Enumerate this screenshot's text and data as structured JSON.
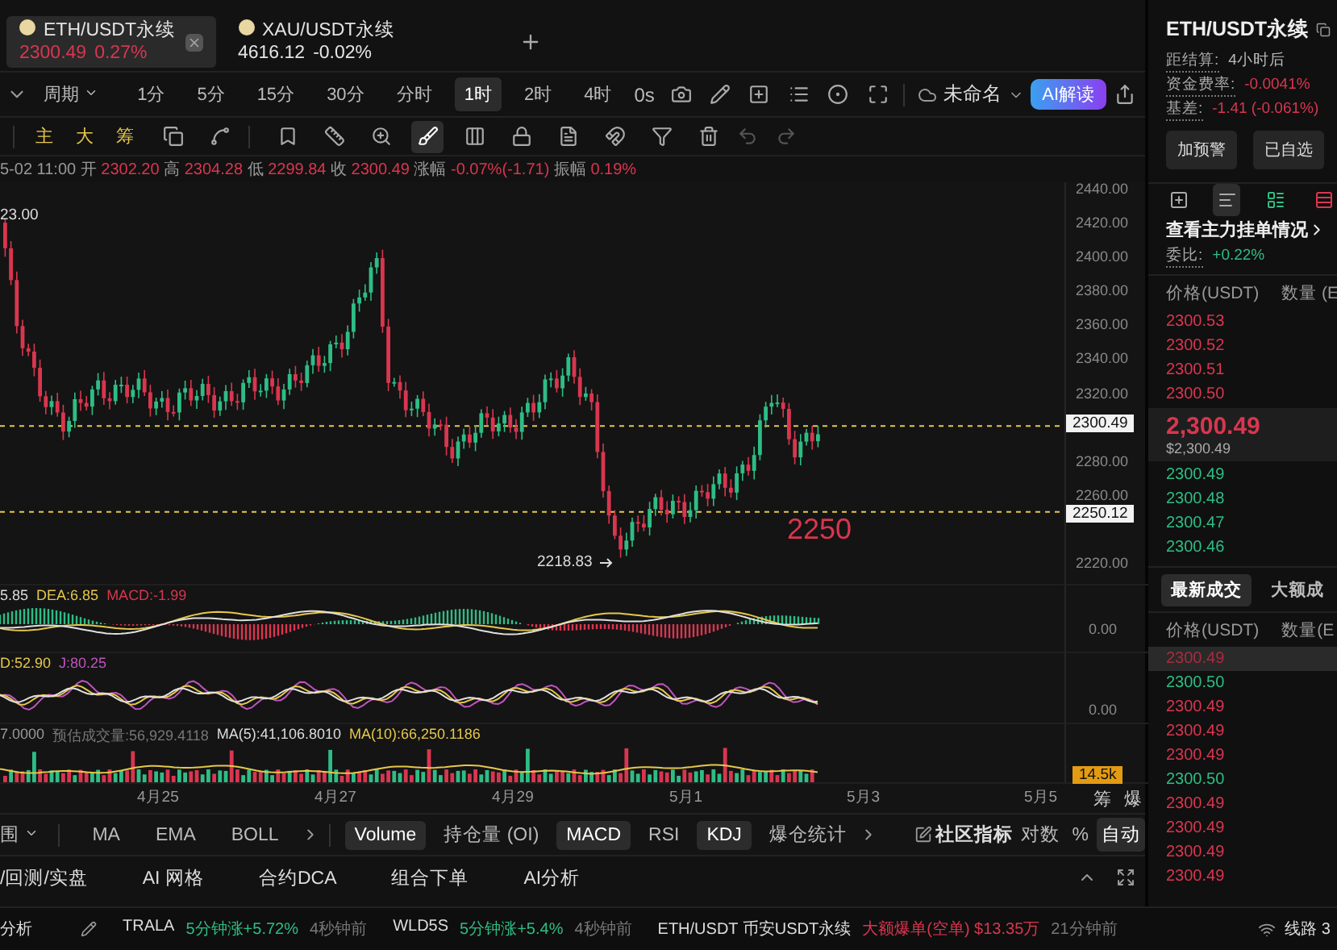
{
  "tabs": [
    {
      "symbol": "ETH/USDT永续",
      "price": "2300.49",
      "change": "0.27%",
      "selected": true
    },
    {
      "symbol": "XAU/USDT永续",
      "price": "4616.12",
      "change": "-0.02%",
      "selected": false
    }
  ],
  "timeframes": {
    "period_label": "周期",
    "items": [
      {
        "label": "1分",
        "selected": false
      },
      {
        "label": "5分",
        "selected": false
      },
      {
        "label": "15分",
        "selected": false
      },
      {
        "label": "30分",
        "selected": false
      },
      {
        "label": "分时",
        "selected": false
      },
      {
        "label": "1时",
        "selected": true
      },
      {
        "label": "2时",
        "selected": false
      },
      {
        "label": "4时",
        "selected": false
      }
    ],
    "countdown": "0s",
    "layout_name": "未命名",
    "ai_button": "AI解读"
  },
  "drawing_toolbar": {
    "chart_modes": [
      "主",
      "大",
      "筹"
    ],
    "tools": [
      {
        "selected": false
      },
      {
        "selected": false
      },
      {
        "selected": false
      },
      {
        "selected": false
      },
      {
        "selected": false
      },
      {
        "selected": true
      },
      {
        "selected": false
      },
      {
        "selected": false
      },
      {
        "selected": false
      },
      {
        "selected": false
      },
      {
        "selected": false
      },
      {
        "selected": false
      }
    ]
  },
  "ohlc": {
    "time": "5-02 11:00",
    "items": [
      {
        "label": "开",
        "value": "2302.20"
      },
      {
        "label": "高",
        "value": "2304.28"
      },
      {
        "label": "低",
        "value": "2299.84"
      },
      {
        "label": "收",
        "value": "2300.49"
      },
      {
        "label": "涨幅",
        "value": "-0.07%(-1.71)"
      },
      {
        "label": "振幅",
        "value": "0.19%"
      }
    ]
  },
  "price_chart": {
    "high_label": "23.00",
    "low_label": "2218.83",
    "annotation": "2250",
    "axis": [
      {
        "kind": "tick",
        "label": "2440.00"
      },
      {
        "kind": "tick",
        "label": "2420.00"
      },
      {
        "kind": "tick",
        "label": "2400.00"
      },
      {
        "kind": "tick",
        "label": "2380.00"
      },
      {
        "kind": "tick",
        "label": "2360.00"
      },
      {
        "kind": "tick",
        "label": "2340.00"
      },
      {
        "kind": "tick",
        "label": "2320.00"
      },
      {
        "kind": "covered"
      },
      {
        "kind": "tick",
        "label": "2280.00"
      },
      {
        "kind": "tick",
        "label": "2260.00"
      },
      {
        "kind": "covered"
      },
      {
        "kind": "tick",
        "label": "2220.00"
      }
    ],
    "last_price_tag": "2300.49",
    "line_tag": "2250.12"
  },
  "macd": {
    "legend": [
      {
        "text": "5.85",
        "kind": "dif"
      },
      {
        "text": "DEA:6.85",
        "kind": "dea"
      },
      {
        "text": "MACD:-1.99",
        "kind": "macd"
      }
    ],
    "axis": "0.00"
  },
  "kdj": {
    "legend": [
      {
        "text": "D:52.90",
        "kind": "d"
      },
      {
        "text": "J:80.25",
        "kind": "j"
      }
    ],
    "axis": "0.00"
  },
  "volume": {
    "legend": [
      {
        "text": "7.0000",
        "kind": "plain"
      },
      {
        "text": "预估成交量:56,929.4118",
        "kind": "muted"
      },
      {
        "text": "MA(5):41,106.8010",
        "kind": "ma5"
      },
      {
        "text": "MA(10):66,250.1186",
        "kind": "ma10"
      }
    ],
    "tag": "14.5k"
  },
  "dates": [
    "4月25",
    "4月27",
    "4月29",
    "5月1",
    "5月3",
    "5月5"
  ],
  "corner_labels": [
    "筹",
    "爆"
  ],
  "indicator_bar": {
    "range_label": "围",
    "main": [
      "MA",
      "EMA",
      "BOLL"
    ],
    "sub": [
      {
        "label": "Volume",
        "selected": true
      },
      {
        "label": "持仓量 (OI)",
        "selected": false
      },
      {
        "label": "MACD",
        "selected": true
      },
      {
        "label": "RSI",
        "selected": false
      },
      {
        "label": "KDJ",
        "selected": true
      },
      {
        "label": "爆仓统计",
        "selected": false
      }
    ],
    "community": "社区指标",
    "scales": [
      {
        "label": "对数",
        "selected": false
      },
      {
        "label": "%",
        "selected": false
      },
      {
        "label": "自动",
        "selected": true
      }
    ]
  },
  "tools_bar": [
    "/回测/实盘",
    "AI 网格",
    "合约DCA",
    "组合下单",
    "AI分析"
  ],
  "ticker": {
    "title": "分析",
    "items": [
      {
        "symbol": "TRALA",
        "signal": "5分钟涨+5.72%",
        "time": "4秒钟前",
        "kind": "rise"
      },
      {
        "symbol": "WLD5S",
        "signal": "5分钟涨+5.4%",
        "time": "4秒钟前",
        "kind": "rise"
      },
      {
        "symbol": "ETH/USDT 币安USDT永续",
        "signal": "大额爆单(空单) $13.35万",
        "time": "21分钟前",
        "kind": "liquidation"
      }
    ],
    "line": "线路 3"
  },
  "side_panel": {
    "title": "ETH/USDT永续",
    "info": [
      {
        "label": "距结算:",
        "value": "4小时后",
        "kind": "plain"
      },
      {
        "label": "资金费率:",
        "value": "-0.0041%",
        "kind": "down"
      },
      {
        "label": "基差:",
        "value": "-1.41 (-0.061%)",
        "kind": "down"
      }
    ],
    "buttons": [
      "加预警",
      "已自选"
    ],
    "views": [
      {
        "selected": false
      },
      {
        "selected": true
      },
      {
        "selected": false
      },
      {
        "selected": false
      }
    ],
    "depth_link": "查看主力挂单情况",
    "ratio_label": "委比:",
    "ratio_value": "+0.22%",
    "book_headers": [
      "价格(USDT)",
      "数量 (E"
    ],
    "asks": [
      "2300.53",
      "2300.52",
      "2300.51",
      "2300.50"
    ],
    "last_price": "2,300.49",
    "last_price_usd": "$2,300.49",
    "bids": [
      "2300.49",
      "2300.48",
      "2300.47",
      "2300.46"
    ],
    "trade_tabs": [
      {
        "label": "最新成交",
        "selected": true
      },
      {
        "label": "大额成",
        "selected": false
      }
    ],
    "trade_headers": [
      "价格(USDT)",
      "数量(E"
    ],
    "trades": [
      {
        "price": "2300.49",
        "kind": "sell",
        "selected": true
      },
      {
        "price": "2300.50",
        "kind": "buy",
        "selected": false
      },
      {
        "price": "2300.49",
        "kind": "sell",
        "selected": false
      },
      {
        "price": "2300.49",
        "kind": "sell",
        "selected": false
      },
      {
        "price": "2300.49",
        "kind": "sell",
        "selected": false
      },
      {
        "price": "2300.50",
        "kind": "buy",
        "selected": false
      },
      {
        "price": "2300.49",
        "kind": "sell",
        "selected": false
      },
      {
        "price": "2300.49",
        "kind": "sell",
        "selected": false
      },
      {
        "price": "2300.49",
        "kind": "sell",
        "selected": false
      },
      {
        "price": "2300.49",
        "kind": "sell",
        "selected": false
      }
    ]
  }
}
